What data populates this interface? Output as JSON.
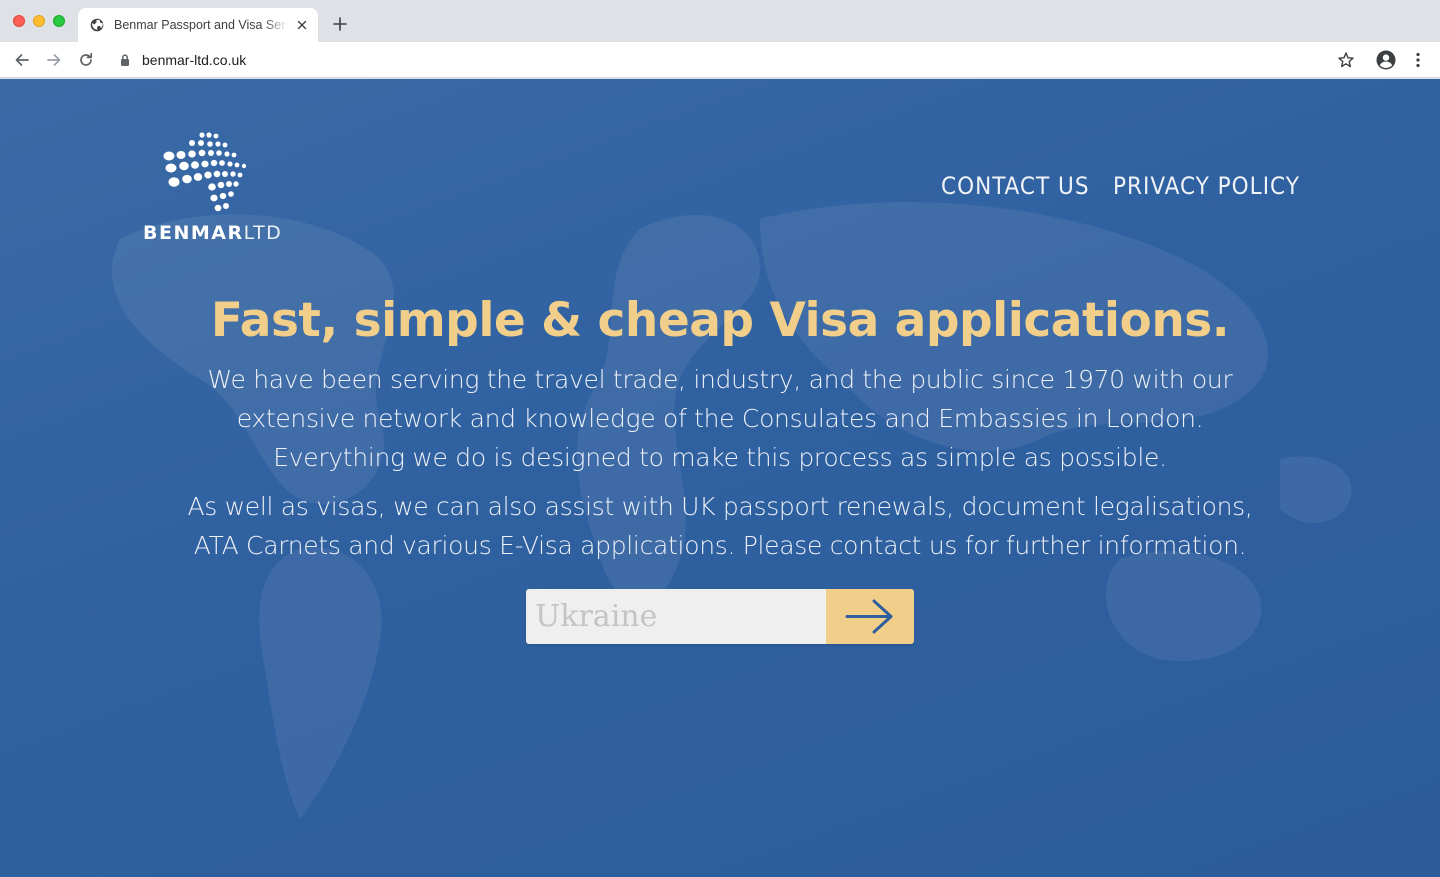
{
  "browser": {
    "tab_title": "Benmar Passport and Visa Services",
    "url": "benmar-ltd.co.uk"
  },
  "logo": {
    "brand_bold": "BENMAR",
    "brand_light": "LTD"
  },
  "nav": {
    "contact": "CONTACT US",
    "privacy": "PRIVACY POLICY"
  },
  "hero": {
    "headline": "Fast, simple & cheap Visa applications.",
    "paragraph1": [
      "We have been serving the travel trade, industry, and the public since 1970 with our",
      "extensive network and knowledge of the Consulates and Embassies in London.",
      "Everything we do is designed to make this process as simple as possible."
    ],
    "paragraph2": [
      "As well as visas, we can also assist with UK passport renewals, document legalisations,",
      "ATA Carnets and various E-Visa applications. Please contact us for further information."
    ]
  },
  "search": {
    "placeholder": "Ukraine",
    "value": "",
    "submit_icon": "arrow-right-icon"
  },
  "colors": {
    "background": "#3063a2",
    "accent": "#f1cf8a",
    "text": "#eef2f8"
  }
}
